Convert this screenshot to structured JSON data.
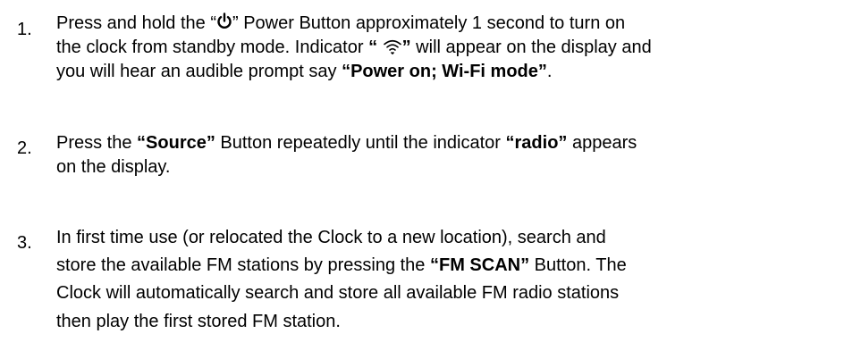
{
  "steps": [
    {
      "number": "1.",
      "lines": [
        {
          "a": "Press and hold the “",
          "icon": "power-icon",
          "b": "” Power Button approximately  1 second to turn on"
        },
        {
          "a": "the clock  from standby mode. Indicator ",
          "bold_open": "“ ",
          "icon": "wifi-icon",
          "bold_close": "”",
          "b": " will appear on the display and"
        },
        {
          "a": "you will  hear an  audible prompt say ",
          "bold": "“Power on; Wi-Fi mode”",
          "b": "."
        }
      ]
    },
    {
      "number": "2.",
      "lines": [
        {
          "a": "Press the ",
          "bold1": "“Source”",
          "b": " Button repeatedly until the indicator ",
          "bold2": "“radio”",
          "c": " appears"
        },
        {
          "a": "on the  display."
        }
      ]
    },
    {
      "number": "3.",
      "lines": [
        {
          "a": "In first time use (or relocated the Clock to a new location), search and"
        },
        {
          "a": "store the  available FM stations by pressing the ",
          "bold": "“FM SCAN”",
          "b": " Button. The"
        },
        {
          "a": "Clock will  automatically search and store all available FM radio stations"
        },
        {
          "a": "then play the  first stored FM station."
        }
      ]
    }
  ]
}
